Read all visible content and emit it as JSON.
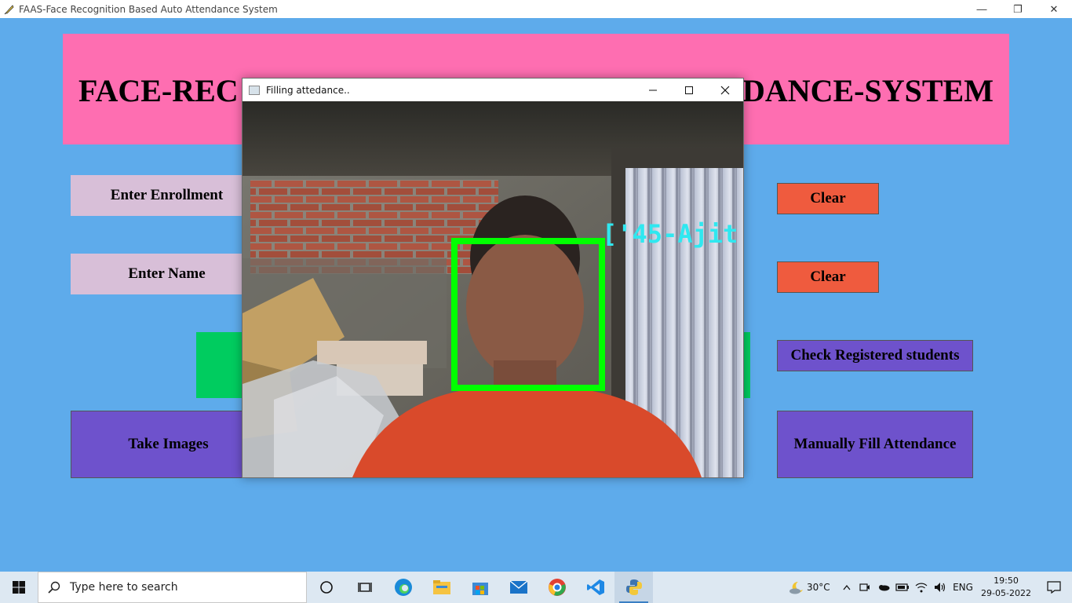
{
  "window": {
    "title": "FAAS-Face Recognition Based Auto Attendance System",
    "controls": {
      "minimize": "—",
      "restore": "❐",
      "close": "✕"
    }
  },
  "header": {
    "heading_left": "FACE-REC",
    "heading_right": "DANCE-SYSTEM",
    "bg_color": "#fe6eb1"
  },
  "form": {
    "enrollment_label": "Enter Enrollment",
    "name_label": "Enter Name",
    "clear_enrollment": "Clear",
    "clear_name": "Clear",
    "take_images": "Take Images",
    "check_registered": "Check Registered students",
    "manual_fill": "Manually Fill Attendance"
  },
  "popup": {
    "title": "Filling attedance..",
    "recognized_label": "['45-Ajit']",
    "box_color": "#00ff00",
    "label_color": "#2fe8f0"
  },
  "taskbar": {
    "search_placeholder": "Type here to search",
    "apps": [
      "task-view",
      "edge",
      "file-explorer",
      "microsoft-store",
      "mail",
      "chrome",
      "vscode",
      "python"
    ],
    "weather": "30°C",
    "language": "ENG",
    "time": "19:50",
    "date": "29-05-2022"
  },
  "colors": {
    "background": "#5eabeb",
    "clear_button": "#ef5b3e",
    "purple_button": "#6e52cc",
    "label_box": "#d8bfd8",
    "green_block": "#00cc5f"
  }
}
